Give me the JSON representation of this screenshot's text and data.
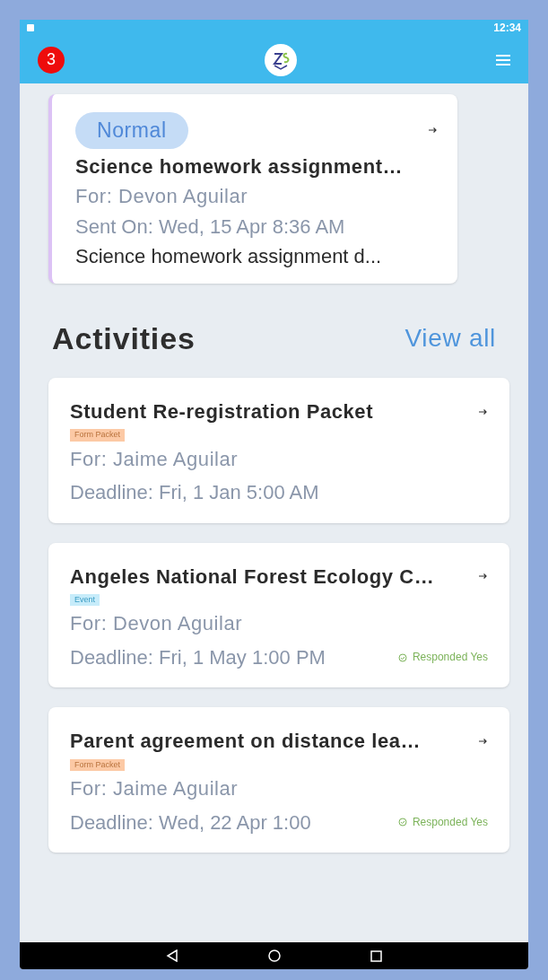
{
  "status_bar": {
    "time": "12:34"
  },
  "app_bar": {
    "notification_count": "3"
  },
  "message": {
    "priority": "Normal",
    "title": "Science homework assignment…",
    "for": "For: Devon Aguilar",
    "sent": "Sent On: Wed, 15 Apr 8:36 AM",
    "preview": "Science homework assignment d..."
  },
  "activities": {
    "heading": "Activities",
    "view_all": "View all",
    "items": [
      {
        "title": "Student Re-registration Packet",
        "tag": "Form Packet",
        "kind": "form",
        "for": "For: Jaime Aguilar",
        "deadline": "Deadline: Fri, 1 Jan 5:00 AM"
      },
      {
        "title": "Angeles National Forest Ecology C…",
        "tag": "Event",
        "kind": "event",
        "for": "For: Devon Aguilar",
        "deadline": "Deadline: Fri, 1 May 1:00 PM",
        "response": "Responded Yes"
      },
      {
        "title": "Parent agreement on distance lea…",
        "tag": "Form Packet",
        "kind": "form",
        "for": "For: Jaime Aguilar",
        "deadline": "Deadline: Wed, 22 Apr 1:00",
        "response": "Responded Yes"
      }
    ]
  }
}
